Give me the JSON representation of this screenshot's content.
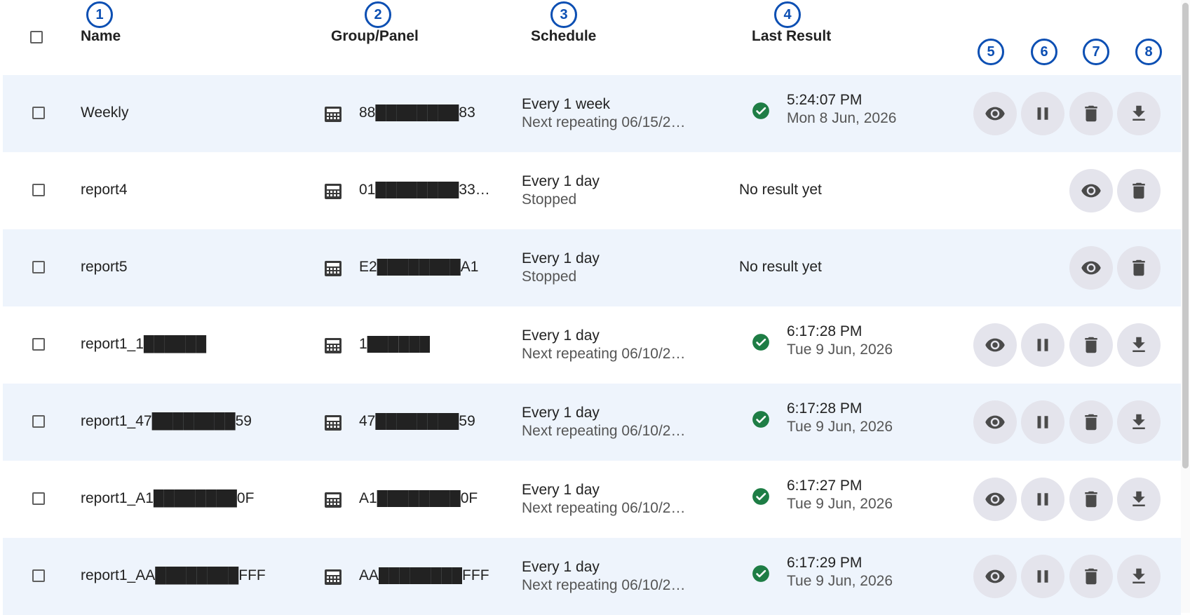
{
  "columns": {
    "name": "Name",
    "group": "Group/Panel",
    "schedule": "Schedule",
    "last_result": "Last Result"
  },
  "badges": [
    "1",
    "2",
    "3",
    "4",
    "5",
    "6",
    "7",
    "8"
  ],
  "rows": [
    {
      "name": "Weekly",
      "group": "88████████83",
      "schedule": "Every 1 week",
      "next": "Next repeating 06/15/2…",
      "result": {
        "time": "5:24:07 PM",
        "date": "Mon 8 Jun, 2026"
      },
      "actions": [
        "view",
        "pause",
        "delete",
        "download"
      ]
    },
    {
      "name": "report4",
      "group": "01████████333…",
      "schedule": "Every 1 day",
      "next": "Stopped",
      "result": {
        "none": "No result yet"
      },
      "actions": [
        "view",
        "delete"
      ]
    },
    {
      "name": "report5",
      "group": "E2████████A1",
      "schedule": "Every 1 day",
      "next": "Stopped",
      "result": {
        "none": "No result yet"
      },
      "actions": [
        "view",
        "delete"
      ]
    },
    {
      "name": "report1_1██████",
      "group": "1██████",
      "schedule": "Every 1 day",
      "next": "Next repeating 06/10/2…",
      "result": {
        "time": "6:17:28 PM",
        "date": "Tue 9 Jun, 2026"
      },
      "actions": [
        "view",
        "pause",
        "delete",
        "download"
      ]
    },
    {
      "name": "report1_47████████59",
      "group": "47████████59",
      "schedule": "Every 1 day",
      "next": "Next repeating 06/10/2…",
      "result": {
        "time": "6:17:28 PM",
        "date": "Tue 9 Jun, 2026"
      },
      "actions": [
        "view",
        "pause",
        "delete",
        "download"
      ]
    },
    {
      "name": "report1_A1████████0F",
      "group": "A1████████0F",
      "schedule": "Every 1 day",
      "next": "Next repeating 06/10/2…",
      "result": {
        "time": "6:17:27 PM",
        "date": "Tue 9 Jun, 2026"
      },
      "actions": [
        "view",
        "pause",
        "delete",
        "download"
      ]
    },
    {
      "name": "report1_AA████████FFF",
      "group": "AA████████FFF",
      "schedule": "Every 1 day",
      "next": "Next repeating 06/10/2…",
      "result": {
        "time": "6:17:29 PM",
        "date": "Tue 9 Jun, 2026"
      },
      "actions": [
        "view",
        "pause",
        "delete",
        "download"
      ]
    }
  ],
  "icons": {
    "view": "eye-icon",
    "pause": "pause-icon",
    "delete": "trash-icon",
    "download": "download-icon",
    "panel": "calculator-icon",
    "ok": "check-circle-icon"
  },
  "colors": {
    "accent": "#0c4fb3",
    "ok": "#1e7d45",
    "row_alt": "#eef4fc",
    "action_bg": "#e4e4ec"
  }
}
